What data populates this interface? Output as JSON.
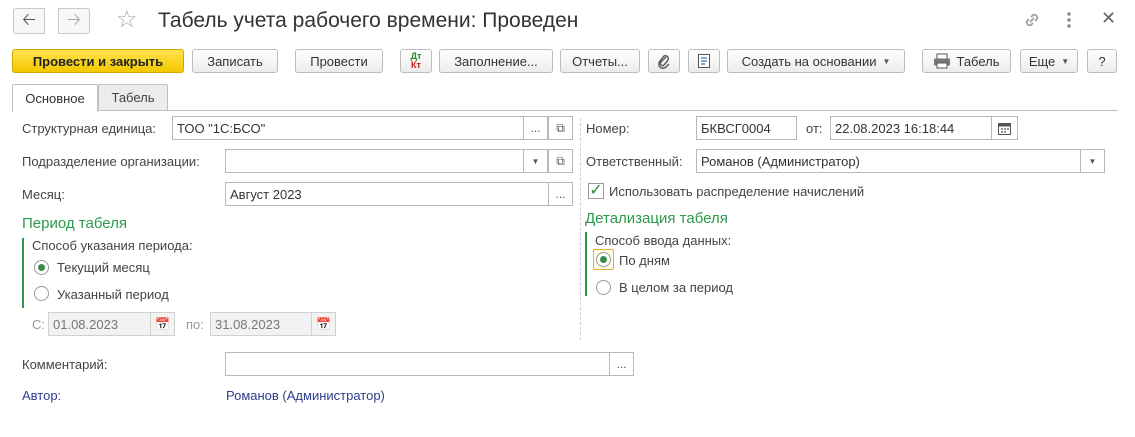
{
  "header": {
    "title": "Табель учета рабочего времени: Проведен"
  },
  "toolbar": {
    "post_close": "Провести и закрыть",
    "save": "Записать",
    "post": "Провести",
    "fill": "Заполнение...",
    "reports": "Отчеты...",
    "create_based": "Создать на основании",
    "timesheet": "Табель",
    "more": "Еще",
    "help": "?",
    "dt_kt_top": "Дт",
    "dt_kt_bottom": "Кт"
  },
  "tabs": [
    {
      "label": "Основное",
      "active": true
    },
    {
      "label": "Табель",
      "active": false
    }
  ],
  "form": {
    "struct_unit": {
      "label": "Структурная единица:",
      "value": "ТОО \"1С:БСО\""
    },
    "subdivision": {
      "label": "Подразделение организации:",
      "value": ""
    },
    "month": {
      "label": "Месяц:",
      "value": "Август 2023"
    },
    "number": {
      "label": "Номер:",
      "value": "БКВСГ0004"
    },
    "date": {
      "label": "от:",
      "value": "22.08.2023 16:18:44"
    },
    "responsible": {
      "label": "Ответственный:",
      "value": "Романов (Администратор)"
    },
    "use_distribution": {
      "label": "Использовать распределение начислений",
      "checked": true
    },
    "period_section": {
      "title": "Период табеля",
      "method_label": "Способ указания периода:",
      "options": [
        "Текущий месяц",
        "Указанный период"
      ],
      "selected": "Текущий месяц",
      "from_label": "С:",
      "from_value": "01.08.2023",
      "to_label": "по:",
      "to_value": "31.08.2023"
    },
    "detail_section": {
      "title": "Детализация табеля",
      "input_label": "Способ ввода данных:",
      "options": [
        "По дням",
        "В целом за период"
      ],
      "selected": "По дням"
    },
    "comment": {
      "label": "Комментарий:",
      "value": ""
    },
    "author": {
      "label": "Автор:",
      "value": "Романов (Администратор)"
    }
  },
  "colors": {
    "primary_button": "#f3c800",
    "section_accent": "#2b9a4a",
    "link": "#2c3e8c"
  }
}
